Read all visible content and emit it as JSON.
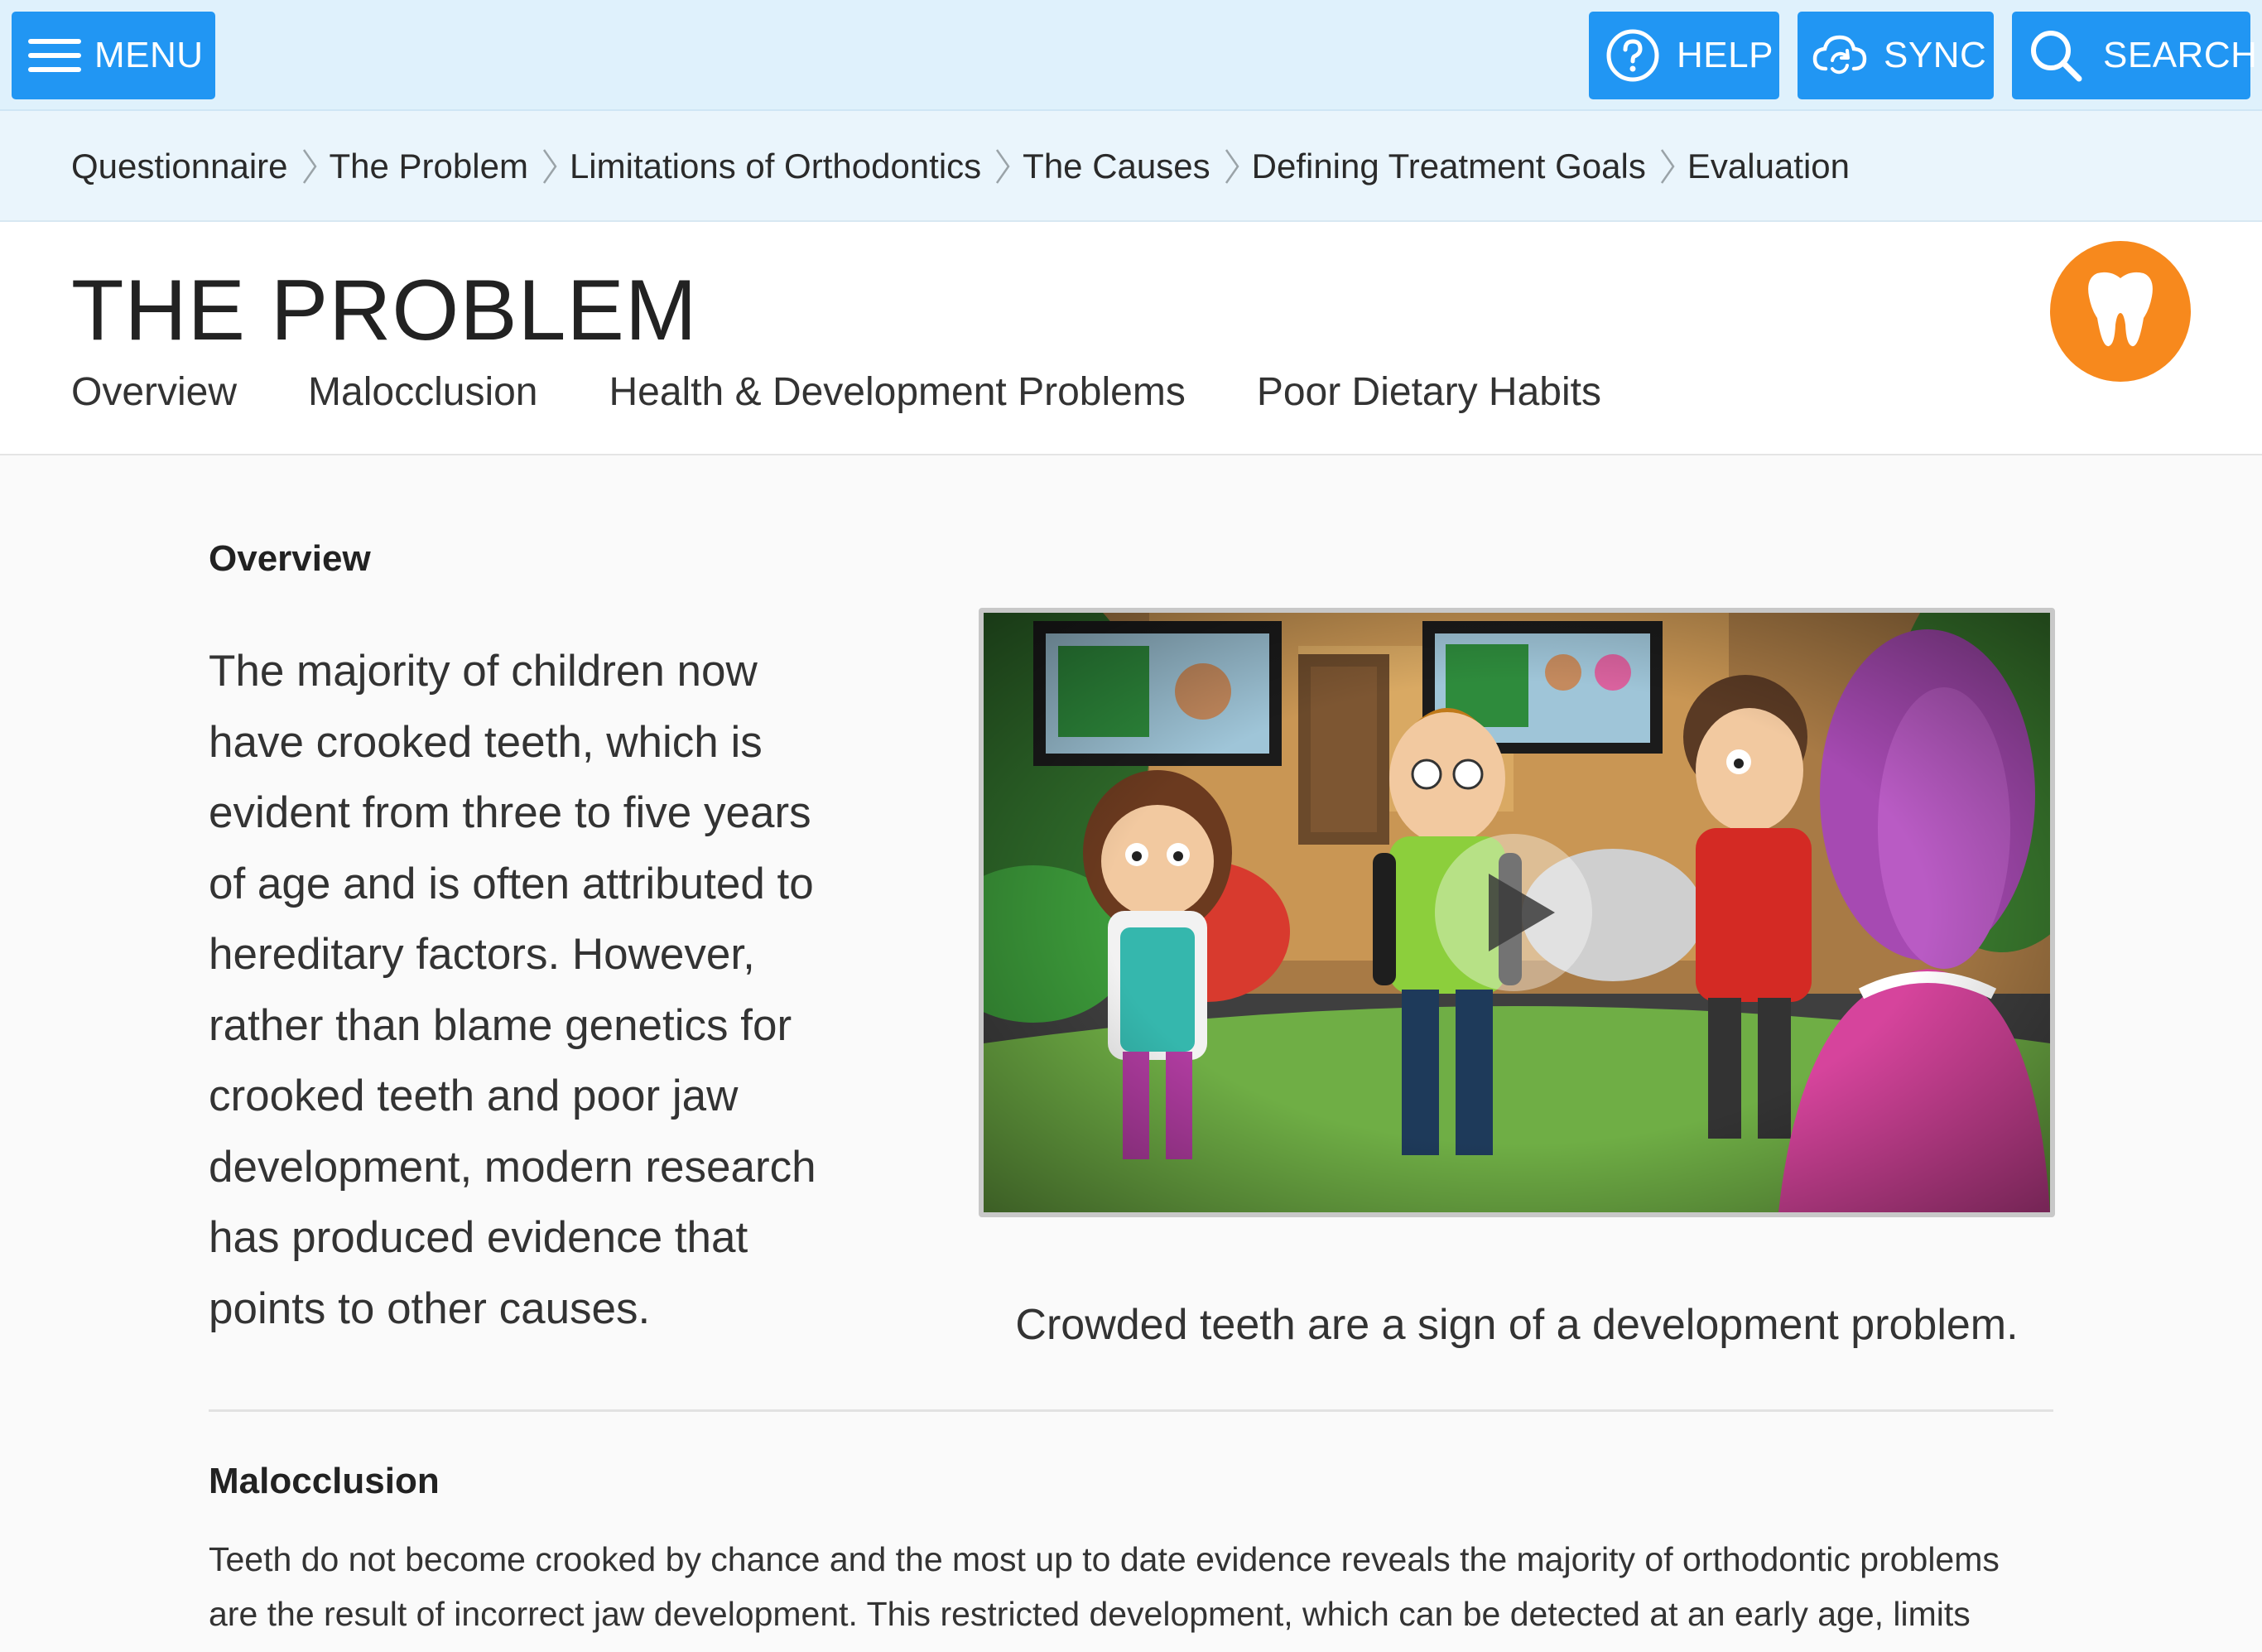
{
  "topbar": {
    "menu_label": "MENU",
    "help_label": "HELP",
    "sync_label": "SYNC",
    "search_label": "SEARCH",
    "accent_color": "#2196f3"
  },
  "breadcrumb": {
    "items": [
      {
        "label": "Questionnaire"
      },
      {
        "label": "The Problem"
      },
      {
        "label": "Limitations of Orthodontics"
      },
      {
        "label": "The Causes"
      },
      {
        "label": "Defining Treatment Goals"
      },
      {
        "label": "Evaluation"
      }
    ],
    "active_index": 1,
    "active_color": "#f7891d"
  },
  "header": {
    "title": "THE PROBLEM",
    "tabs": [
      {
        "label": "Overview"
      },
      {
        "label": "Malocclusion"
      },
      {
        "label": "Health & Development Problems"
      },
      {
        "label": "Poor Dietary Habits"
      }
    ],
    "badge_icon": "tooth-icon",
    "badge_color": "#f7891d"
  },
  "overview": {
    "heading": "Overview",
    "text": "The majority of children now have crooked teeth, which is evident from three to five years of age and is often attributed to hereditary factors. However, rather than blame genetics for crooked teeth and poor jaw development, modern research has produced evidence that points to other causes.",
    "video_icon": "play-icon",
    "caption": "Crowded teeth are a sign of a development problem."
  },
  "malocclusion": {
    "heading": "Malocclusion",
    "text": "Teeth do not become crooked by chance and the most up to date evidence reveals the majority of orthodontic problems are the result of incorrect jaw development. This restricted development, which can be detected at an early age, limits"
  }
}
